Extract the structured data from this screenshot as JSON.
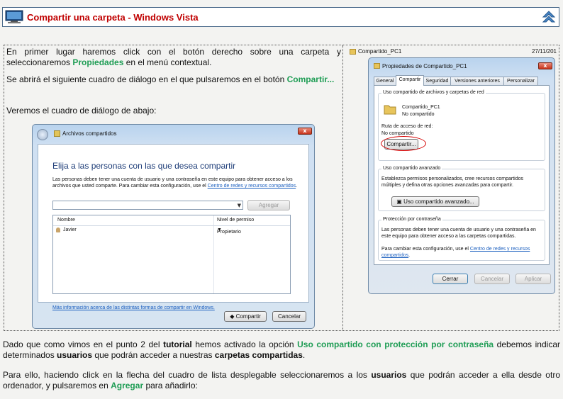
{
  "header": {
    "title": "Compartir una carpeta - Windows Vista",
    "up_icon": "up-chevron-icon",
    "pc_icon": "computer-icon"
  },
  "intro": {
    "p1_a": "En primer lugar haremos click con el botón derecho sobre una carpeta y seleccionaremos ",
    "p1_hl": "Propiedades",
    "p1_b": " en el menú contextual.",
    "p2_a": "Se abrirá el siguiente cuadro de diálogo en el que pulsaremos en el botón ",
    "p2_hl": "Compartir...",
    "p3": "Veremos el cuadro de diálogo de abajo:"
  },
  "dialog_archivos": {
    "title": "Archivos compartidos",
    "close": "x",
    "heading": "Elija a las personas con las que desea compartir",
    "desc": "Las personas deben tener una cuenta de usuario y una contraseña en este equipo para obtener acceso a los archivos que usted comparte. Para cambiar esta configuración, use el ",
    "desc_link": "Centro de redes y recursos compartidos",
    "desc_end": ".",
    "add_button": "Agregar",
    "columns": [
      "Nombre",
      "Nivel de permiso"
    ],
    "rows": [
      {
        "name": "Javier",
        "permission": "Propietario"
      }
    ],
    "more_link": "Más información acerca de las distintas formas de compartir en Windows.",
    "share_button": "Compartir",
    "cancel_button": "Cancelar"
  },
  "properties_window": {
    "explorer_folder": "Compartido_PC1",
    "explorer_date": "27/11/201",
    "title": "Propiedades de Compartido_PC1",
    "close": "x",
    "tabs": [
      "General",
      "Compartir",
      "Seguridad",
      "Versiones anteriores",
      "Personalizar"
    ],
    "active_tab": "Compartir",
    "group1_title": "Uso compartido de archivos y carpetas de red",
    "folder_name": "Compartido_PC1",
    "folder_status": "No compartido",
    "path_label": "Ruta de acceso de red:",
    "path_value": "No compartido",
    "share_button": "Compartir...",
    "group2_title": "Uso compartido avanzado",
    "group2_text": "Establezca permisos personalizados, cree recursos compartidos múltiples y defina otras opciones avanzadas para compartir.",
    "advanced_button": "Uso compartido avanzado...",
    "group3_title": "Protección por contraseña",
    "group3_text": "Las personas deben tener una cuenta de usuario y una contraseña en este equipo para obtener acceso a las carpetas compartidas.",
    "group3_text2": "Para cambiar esta configuración, use el ",
    "group3_link": "Centro de redes y recursos compartidos",
    "group3_end": ".",
    "ok_button": "Cerrar",
    "cancel_button": "Cancelar",
    "apply_button": "Aplicar"
  },
  "outro": {
    "p4_a": "Dado que como vimos en el punto 2 del ",
    "p4_b": "tutorial",
    "p4_c": " hemos activado la opción ",
    "p4_d": "Uso compartido con protección por contraseña",
    "p4_e": " debemos indicar determinados ",
    "p4_f": "usuarios",
    "p4_g": " que podrán acceder a nuestras ",
    "p4_h": "carpetas compartidas",
    "p4_i": ".",
    "p5_a": "Para ello, haciendo click en la flecha del cuadro de lista desplegable seleccionaremos a los ",
    "p5_b": "usuarios",
    "p5_c": " que podrán acceder a ella desde otro ordenador, y pulsaremos en ",
    "p5_d": "Agregar",
    "p5_e": " para añadirlo:"
  },
  "colors": {
    "title_red": "#c00000",
    "highlight_green": "#1f9d55"
  }
}
